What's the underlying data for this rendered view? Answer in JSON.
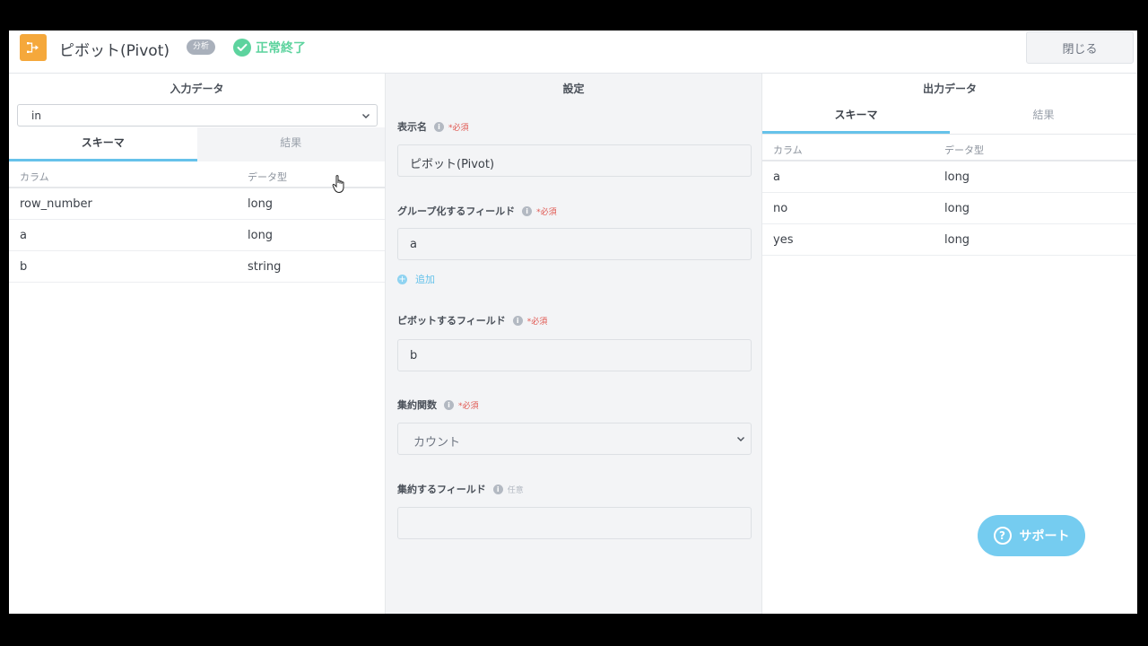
{
  "header": {
    "title": "ピボット(Pivot)",
    "badge": "分析",
    "status": "正常終了",
    "close_label": "閉じる",
    "icon": "pivot-node-icon",
    "accent": "#f5a83b"
  },
  "input_panel": {
    "heading": "入力データ",
    "dataset": "in",
    "tabs": [
      {
        "label": "スキーマ",
        "active": true
      },
      {
        "label": "結果",
        "active": false
      }
    ],
    "columns": [
      "カラム",
      "データ型"
    ],
    "rows": [
      {
        "name": "row_number",
        "type": "long"
      },
      {
        "name": "a",
        "type": "long"
      },
      {
        "name": "b",
        "type": "string"
      }
    ]
  },
  "settings_panel": {
    "heading": "設定",
    "display_name": {
      "label": "表示名",
      "required": "*必須",
      "value": "ピボット(Pivot)"
    },
    "group_fields": {
      "label": "グループ化するフィールド",
      "required": "*必須",
      "value": "a",
      "add_label": "追加"
    },
    "pivot_field": {
      "label": "ピボットするフィールド",
      "required": "*必須",
      "value": "b"
    },
    "aggregate_function": {
      "label": "集約関数",
      "required": "*必須",
      "value": "カウント"
    },
    "aggregate_field": {
      "label": "集約するフィールド",
      "optional": "任意",
      "value": ""
    }
  },
  "output_panel": {
    "heading": "出力データ",
    "tabs": [
      {
        "label": "スキーマ",
        "active": true
      },
      {
        "label": "結果",
        "active": false
      }
    ],
    "columns": [
      "カラム",
      "データ型"
    ],
    "rows": [
      {
        "name": "a",
        "type": "long"
      },
      {
        "name": "no",
        "type": "long"
      },
      {
        "name": "yes",
        "type": "long"
      }
    ]
  },
  "support": {
    "label": "サポート"
  },
  "colors": {
    "success": "#5dd39e",
    "tab_active": "#66c2ea",
    "required": "#e0564f"
  }
}
